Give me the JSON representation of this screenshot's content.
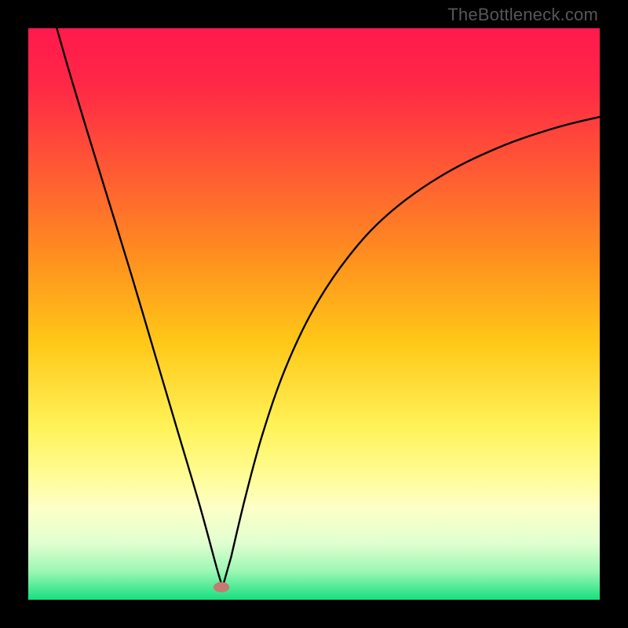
{
  "watermark": "TheBottleneck.com",
  "chart_data": {
    "type": "line",
    "title": "",
    "xlabel": "",
    "ylabel": "",
    "xlim": [
      0,
      100
    ],
    "ylim": [
      0,
      100
    ],
    "axes_visible": false,
    "legend": false,
    "grid": false,
    "gradient_stops": [
      {
        "offset": 0.0,
        "color": "#ff1a4d"
      },
      {
        "offset": 0.1,
        "color": "#ff2846"
      },
      {
        "offset": 0.25,
        "color": "#ff5a34"
      },
      {
        "offset": 0.4,
        "color": "#ff8f1f"
      },
      {
        "offset": 0.55,
        "color": "#ffc818"
      },
      {
        "offset": 0.7,
        "color": "#fff35a"
      },
      {
        "offset": 0.78,
        "color": "#fffc93"
      },
      {
        "offset": 0.84,
        "color": "#fdffc7"
      },
      {
        "offset": 0.9,
        "color": "#e1ffd0"
      },
      {
        "offset": 0.95,
        "color": "#9cf7b4"
      },
      {
        "offset": 1.0,
        "color": "#16e07e"
      }
    ],
    "marker": {
      "x": 33.8,
      "y": 2.2,
      "color": "#c77a72",
      "rx": 1.4,
      "ry": 0.9
    },
    "curve_left": [
      {
        "x": 5.0,
        "y": 100.0
      },
      {
        "x": 7.0,
        "y": 93.0
      },
      {
        "x": 10.0,
        "y": 83.0
      },
      {
        "x": 14.0,
        "y": 70.0
      },
      {
        "x": 18.0,
        "y": 57.0
      },
      {
        "x": 22.0,
        "y": 43.5
      },
      {
        "x": 26.0,
        "y": 30.0
      },
      {
        "x": 30.0,
        "y": 16.5
      },
      {
        "x": 33.0,
        "y": 5.5
      },
      {
        "x": 34.0,
        "y": 2.2
      }
    ],
    "curve_right": [
      {
        "x": 34.0,
        "y": 2.2
      },
      {
        "x": 35.5,
        "y": 7.5
      },
      {
        "x": 38.0,
        "y": 18.0
      },
      {
        "x": 41.0,
        "y": 29.0
      },
      {
        "x": 45.0,
        "y": 40.5
      },
      {
        "x": 50.0,
        "y": 51.0
      },
      {
        "x": 56.0,
        "y": 60.0
      },
      {
        "x": 63.0,
        "y": 67.5
      },
      {
        "x": 72.0,
        "y": 74.0
      },
      {
        "x": 82.0,
        "y": 79.0
      },
      {
        "x": 92.0,
        "y": 82.5
      },
      {
        "x": 100.0,
        "y": 84.5
      }
    ]
  }
}
